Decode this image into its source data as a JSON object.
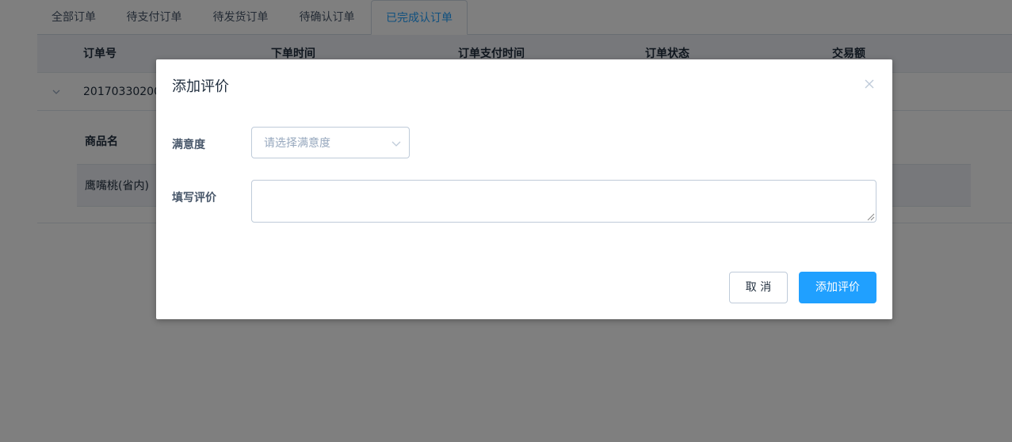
{
  "tabs": [
    {
      "label": "全部订单"
    },
    {
      "label": "待支付订单"
    },
    {
      "label": "待发货订单"
    },
    {
      "label": "待确认订单"
    },
    {
      "label": "已完成认订单",
      "active": true
    }
  ],
  "table": {
    "columns": [
      "订单号",
      "下单时间",
      "订单支付时间",
      "订单状态",
      "交易额"
    ],
    "rows": [
      {
        "order_no": "20170330200"
      }
    ]
  },
  "subtable": {
    "header": "商品名",
    "rows": [
      {
        "name": "鹰嘴桃(省内)"
      }
    ]
  },
  "dialog": {
    "title": "添加评价",
    "satisfaction_label": "满意度",
    "satisfaction_placeholder": "请选择满意度",
    "review_label": "填写评价",
    "review_value": "",
    "cancel_label": "取 消",
    "submit_label": "添加评价"
  },
  "colors": {
    "primary": "#20a0ff",
    "overlay": "rgba(0,0,0,0.5)",
    "border": "#bfcbd9"
  },
  "icons": [
    "close-icon",
    "chevron-down-icon",
    "expand-arrow-icon"
  ]
}
